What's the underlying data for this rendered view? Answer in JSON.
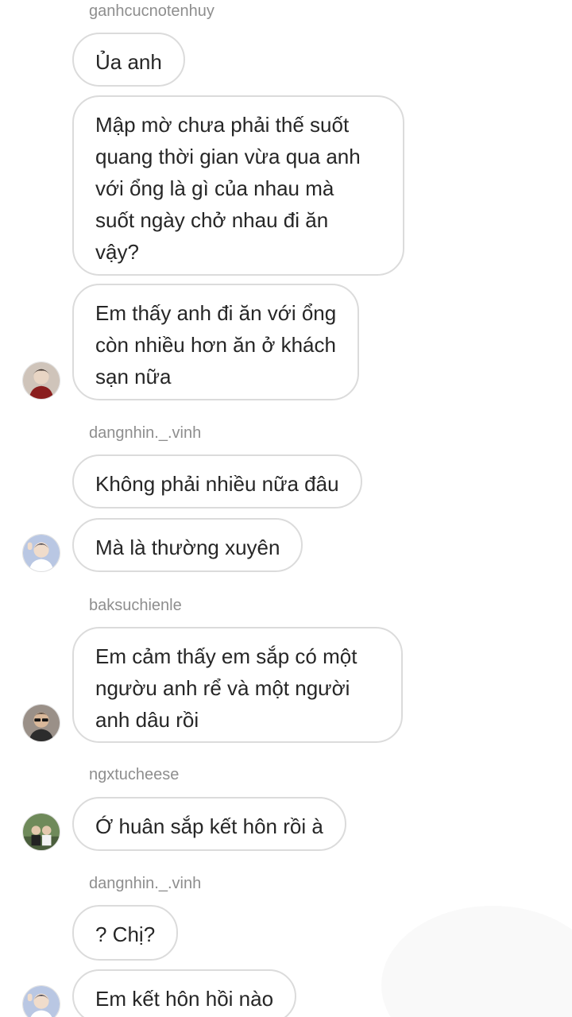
{
  "messages": [
    {
      "username": "ganhcucnotenhuy"
    },
    {
      "text": "Ủa anh"
    },
    {
      "text": "Mập mờ chưa phải thế suốt\nquang thời gian vừa qua anh\nvới ổng là gì của nhau mà\nsuốt ngày chở nhau đi ăn\nvậy?"
    },
    {
      "text": "Em thấy anh đi ăn với ổng\ncòn nhiều hơn ăn ở khách\nsạn nữa"
    },
    {
      "username": "dangnhin._.vinh"
    },
    {
      "text": "Không phải nhiều nữa đâu"
    },
    {
      "text": "Mà là thường xuyên"
    },
    {
      "username": "baksuchienle"
    },
    {
      "text": "Em cảm thấy em sắp có một\nngườu anh rể và một người\nanh dâu rồi"
    },
    {
      "username": "ngxtucheese"
    },
    {
      "text": "Ớ huân sắp kết hôn rồi à"
    },
    {
      "username": "dangnhin._.vinh"
    },
    {
      "text": "? Chị?"
    },
    {
      "text": "Em kết hôn hồi nào"
    }
  ],
  "colors": {
    "bubble_border": "#dbdbdb",
    "username_text": "#8e8e8e",
    "message_text": "#262626"
  }
}
